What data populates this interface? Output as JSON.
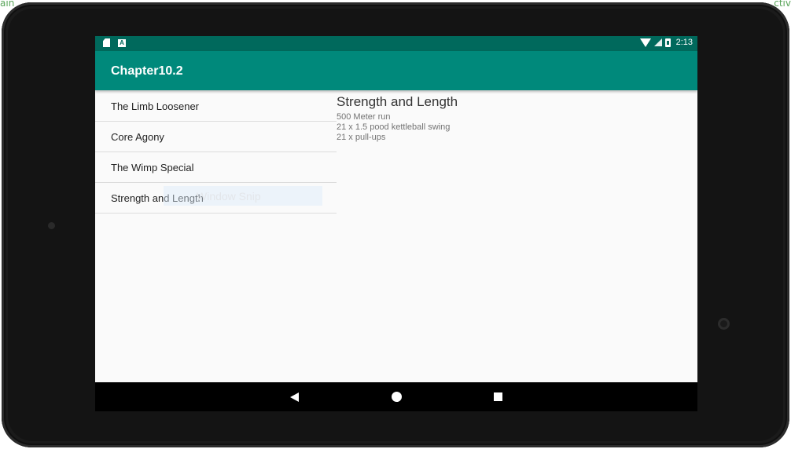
{
  "background": {
    "left_fragment": "ain",
    "right_fragment": "ctiv"
  },
  "status_bar": {
    "icons_left": [
      "sdcard-icon",
      "a-notification-icon"
    ],
    "icons_right": [
      "wifi-icon",
      "signal-icon",
      "battery-icon"
    ],
    "time": "2:13",
    "color": "#00695c"
  },
  "app_bar": {
    "title": "Chapter10.2",
    "color": "#00897b"
  },
  "workouts": {
    "items": [
      {
        "label": "The Limb Loosener"
      },
      {
        "label": "Core Agony"
      },
      {
        "label": "The Wimp Special"
      },
      {
        "label": "Strength and Length"
      }
    ]
  },
  "overlay": {
    "snip_text": "Window Snip"
  },
  "detail": {
    "title": "Strength and Length",
    "lines": [
      "500 Meter run",
      "21 x 1.5 pood kettleball swing",
      "21 x pull-ups"
    ]
  },
  "nav_bar": {
    "buttons": [
      "back-icon",
      "home-icon",
      "recents-icon"
    ]
  }
}
